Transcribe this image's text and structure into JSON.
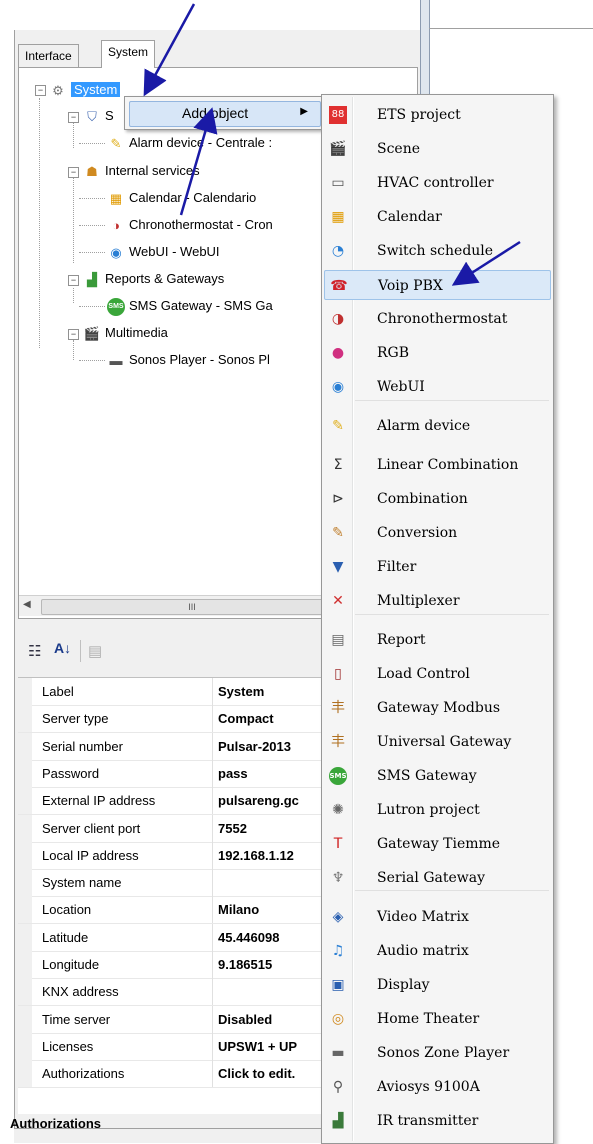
{
  "tabs": [
    {
      "label": "Interface"
    },
    {
      "label": "System"
    }
  ],
  "tree": {
    "root": "System",
    "s_node": "S",
    "alarm": "Alarm device - Centrale :",
    "internal": "Internal services",
    "calendar": "Calendar - Calendario",
    "chrono": "Chronothermostat - Cron",
    "webui": "WebUI - WebUI",
    "reports": "Reports & Gateways",
    "sms": "SMS Gateway - SMS Ga",
    "multimedia": "Multimedia",
    "sonos": "Sonos Player - Sonos Pl"
  },
  "scrollbar": {
    "thumb_grip": "III"
  },
  "context_menu": {
    "add_object": "Add object"
  },
  "submenu": [
    {
      "label": "ETS project",
      "icon": "ets-icon",
      "glyph": "88"
    },
    {
      "label": "Scene",
      "icon": "clapperboard-icon",
      "glyph": "🎬"
    },
    {
      "label": "HVAC controller",
      "icon": "hvac-icon",
      "glyph": "▭"
    },
    {
      "label": "Calendar",
      "icon": "calendar-icon",
      "glyph": "▦"
    },
    {
      "label": "Switch schedule",
      "icon": "switch-schedule-icon",
      "glyph": "◔"
    },
    {
      "label": "Voip PBX",
      "icon": "phone-icon",
      "glyph": "☎"
    },
    {
      "label": "Chronothermostat",
      "icon": "chronothermostat-icon",
      "glyph": "◑"
    },
    {
      "label": "RGB",
      "icon": "rgb-icon",
      "glyph": "●"
    },
    {
      "label": "WebUI",
      "icon": "globe-icon",
      "glyph": "◉"
    },
    {
      "label": "Alarm device",
      "icon": "alarm-icon",
      "glyph": "✎"
    },
    {
      "label": "Linear Combination",
      "icon": "sigma-icon",
      "glyph": "Σ"
    },
    {
      "label": "Combination",
      "icon": "gate-icon",
      "glyph": "⊳"
    },
    {
      "label": "Conversion",
      "icon": "pencil-icon",
      "glyph": "✎"
    },
    {
      "label": "Filter",
      "icon": "funnel-icon",
      "glyph": "▼"
    },
    {
      "label": "Multiplexer",
      "icon": "multiplexer-icon",
      "glyph": "✕"
    },
    {
      "label": "Report",
      "icon": "report-icon",
      "glyph": "▤"
    },
    {
      "label": "Load Control",
      "icon": "battery-icon",
      "glyph": "▯"
    },
    {
      "label": "Gateway Modbus",
      "icon": "signpost-icon",
      "glyph": "丰"
    },
    {
      "label": "Universal Gateway",
      "icon": "signpost-icon",
      "glyph": "丰"
    },
    {
      "label": "SMS Gateway",
      "icon": "sms-icon",
      "glyph": "SMS"
    },
    {
      "label": "Lutron project",
      "icon": "lutron-icon",
      "glyph": "✺"
    },
    {
      "label": "Gateway Tiemme",
      "icon": "tiemme-icon",
      "glyph": "T"
    },
    {
      "label": "Serial Gateway",
      "icon": "serial-icon",
      "glyph": "♆"
    },
    {
      "label": "Video Matrix",
      "icon": "video-matrix-icon",
      "glyph": "◈"
    },
    {
      "label": "Audio matrix",
      "icon": "music-note-icon",
      "glyph": "♫"
    },
    {
      "label": "Display",
      "icon": "monitor-icon",
      "glyph": "▣"
    },
    {
      "label": "Home Theater",
      "icon": "speaker-icon",
      "glyph": "◎"
    },
    {
      "label": "Sonos Zone Player",
      "icon": "sonos-icon",
      "glyph": "▬"
    },
    {
      "label": "Aviosys 9100A",
      "icon": "aviosys-icon",
      "glyph": "⚲"
    },
    {
      "label": "IR transmitter",
      "icon": "ir-icon",
      "glyph": "▟"
    }
  ],
  "properties": [
    {
      "label": "Label",
      "value": "System"
    },
    {
      "label": "Server type",
      "value": "Compact"
    },
    {
      "label": "Serial number",
      "value": "Pulsar-2013"
    },
    {
      "label": "Password",
      "value": "pass"
    },
    {
      "label": "External IP address",
      "value": "pulsareng.gc"
    },
    {
      "label": "Server client port",
      "value": "7552"
    },
    {
      "label": "Local IP address",
      "value": "192.168.1.12"
    },
    {
      "label": "System name",
      "value": ""
    },
    {
      "label": "Location",
      "value": "Milano"
    },
    {
      "label": "Latitude",
      "value": "45.446098"
    },
    {
      "label": "Longitude",
      "value": "9.186515"
    },
    {
      "label": "KNX address",
      "value": ""
    },
    {
      "label": "Time server",
      "value": "Disabled"
    },
    {
      "label": "Licenses",
      "value": "UPSW1 + UP"
    },
    {
      "label": "Authorizations",
      "value": "Click to edit."
    }
  ],
  "description": {
    "title": "Authorizations"
  },
  "colors": {
    "selection": "#3399ff",
    "menu_highlight": "#dbe9f8",
    "arrow": "#1a1aa6"
  }
}
